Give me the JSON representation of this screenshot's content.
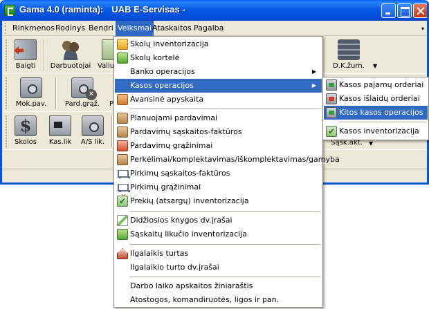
{
  "window": {
    "title_app": "Gama 4.0 (raminta):",
    "title_company": "UAB E-Servisas -"
  },
  "menubar": {
    "items": [
      {
        "label": "Rinkmenos"
      },
      {
        "label": "Rodinys"
      },
      {
        "label": "Bendri"
      },
      {
        "label": "Veiksmai"
      },
      {
        "label": "Ataskaitos"
      },
      {
        "label": "Pagalba"
      }
    ],
    "active": "Veiksmai"
  },
  "toolbar1": {
    "buttons": [
      {
        "label": "Baigti",
        "icon": "exit-door-icon"
      },
      {
        "label": "Darbuotojai",
        "icon": "employees-icon"
      },
      {
        "label": "Valiu",
        "icon": "currency-icon"
      },
      {
        "label": "D.K.žurn.",
        "icon": "journal-icon"
      }
    ]
  },
  "toolbar2": {
    "buttons": [
      {
        "label": "Mok.pav.",
        "icon": "safe-icon"
      },
      {
        "label": "Pard.grąž.",
        "icon": "sales-return-icon"
      },
      {
        "label": "P",
        "icon": "partial-icon"
      }
    ]
  },
  "toolbar3": {
    "buttons": [
      {
        "label": "Skolos",
        "icon": "debts-icon"
      },
      {
        "label": "Kas.lik",
        "icon": "cash-balance-icon"
      },
      {
        "label": "A/S lik.",
        "icon": "account-balance-icon"
      },
      {
        "label": "Sąsk.akt.",
        "icon": "account-act-icon"
      }
    ]
  },
  "veiksmai_menu": {
    "items": [
      {
        "label": "Skolų inventorizacija",
        "icon": "debt-inventory-icon"
      },
      {
        "label": "Skolų kortelė",
        "icon": "debt-card-icon"
      },
      {
        "label": "Banko operacijos",
        "icon": "",
        "submenu": true
      },
      {
        "label": "Kasos operacijos",
        "icon": "",
        "submenu": true,
        "highlighted": true
      },
      {
        "label": "Avansinė apyskaita",
        "icon": "advance-report-icon"
      },
      {
        "label": "Planuojami pardavimai",
        "icon": "planned-sales-icon"
      },
      {
        "label": "Pardavimų sąskaitos-faktūros",
        "icon": "sales-invoice-icon"
      },
      {
        "label": "Pardavimų grąžinimai",
        "icon": "sales-return-icon"
      },
      {
        "label": "Perkėlimai/komplektavimas/iškomplektavimas/gamyba",
        "icon": "transfer-icon"
      },
      {
        "label": "Pirkimų sąskaitos-faktūros",
        "icon": "purchase-invoice-icon"
      },
      {
        "label": "Pirkimų grąžinimai",
        "icon": "purchase-return-icon"
      },
      {
        "label": "Prekių (atsargų) inventorizacija",
        "icon": "stock-inventory-icon"
      },
      {
        "label": "Didžiosios knygos dv.įrašai",
        "icon": "ledger-entry-icon"
      },
      {
        "label": "Sąskaitų likučio inventorizacija",
        "icon": "account-balance-inventory-icon"
      },
      {
        "label": "Ilgalaikis turtas",
        "icon": "fixed-assets-icon"
      },
      {
        "label": "Ilgalaikio turto dv.įrašai",
        "icon": ""
      },
      {
        "label": "Darbo laiko apskaitos žiniaraštis",
        "icon": ""
      },
      {
        "label": "Atostogos, komandiruotės, ligos ir pan.",
        "icon": ""
      }
    ]
  },
  "kasos_submenu": {
    "items": [
      {
        "label": "Kasos pajamų orderiai",
        "icon": "cash-receipt-icon"
      },
      {
        "label": "Kasos išlaidų orderiai",
        "icon": "cash-expense-icon"
      },
      {
        "label": "Kitos kasos operacijos",
        "icon": "other-cash-ops-icon",
        "highlighted": true
      },
      {
        "label": "Kasos inventorizacija",
        "icon": "cash-inventory-icon"
      }
    ]
  },
  "colors": {
    "titlebar": "#0559e6",
    "highlight": "#316ac5",
    "chrome": "#ece9d8"
  }
}
